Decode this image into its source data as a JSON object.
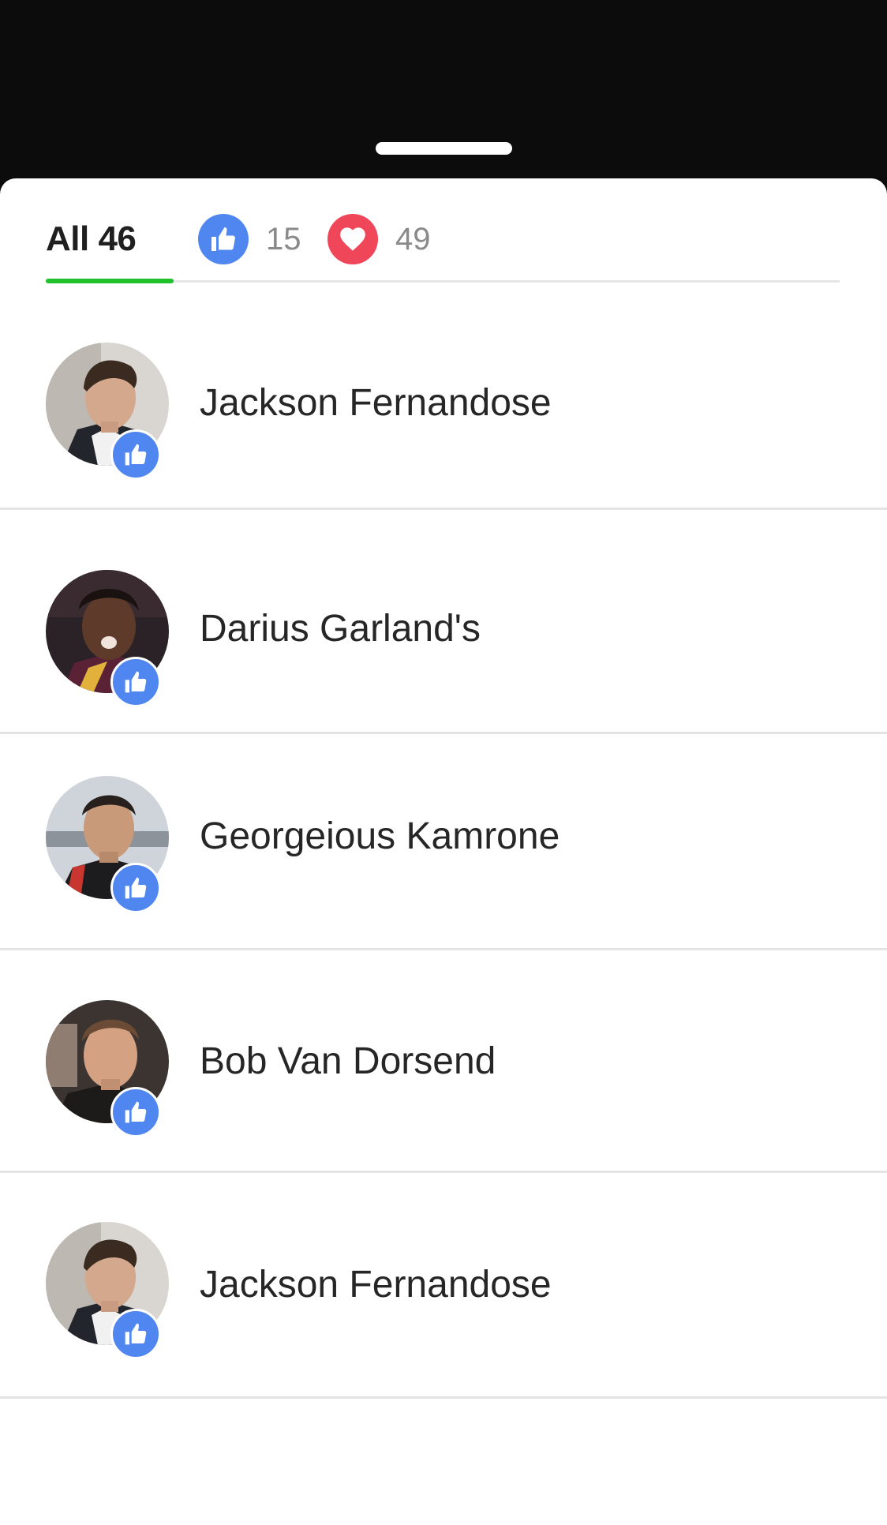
{
  "tabs": {
    "all_label": "All 46",
    "like_count": "15",
    "love_count": "49"
  },
  "colors": {
    "like": "#4f86f0",
    "love": "#f0465a",
    "active_tab": "#21c02d"
  },
  "people": [
    {
      "name": "Jackson Fernandose",
      "reaction": "like-icon"
    },
    {
      "name": "Darius Garland's",
      "reaction": "like-icon"
    },
    {
      "name": "Georgeious Kamrone",
      "reaction": "like-icon"
    },
    {
      "name": "Bob Van Dorsend",
      "reaction": "like-icon"
    },
    {
      "name": "Jackson Fernandose",
      "reaction": "like-icon"
    }
  ]
}
